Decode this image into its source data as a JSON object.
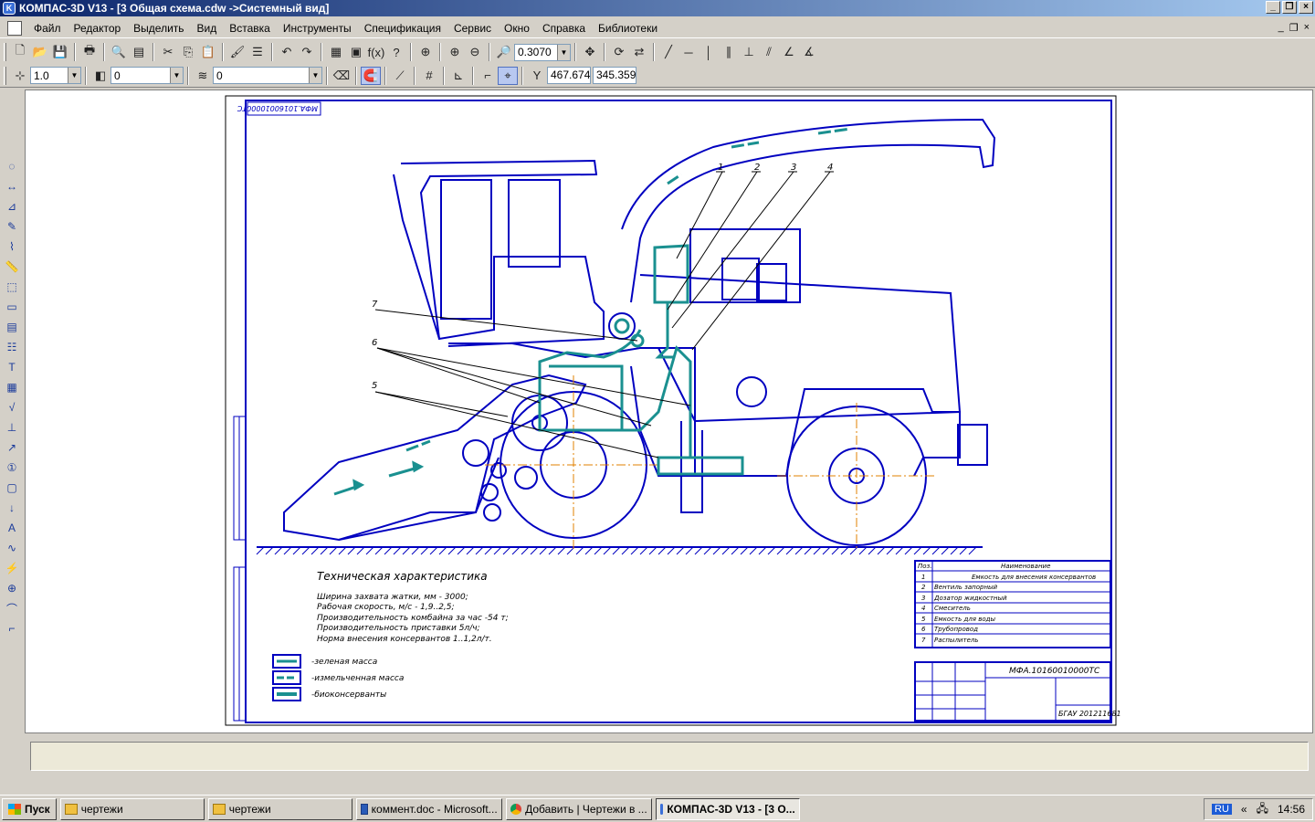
{
  "window": {
    "title": "КОМПАС-3D V13 - [3 Общая схема.cdw ->Системный вид]"
  },
  "menu": [
    "Файл",
    "Редактор",
    "Выделить",
    "Вид",
    "Вставка",
    "Инструменты",
    "Спецификация",
    "Сервис",
    "Окно",
    "Справка",
    "Библиотеки"
  ],
  "toolbar1": {
    "zoom_value": "0.3070"
  },
  "toolbar2": {
    "scale_value": "1.0",
    "layer_value": "0",
    "style_value": "0",
    "x_label": "Y",
    "coord_x": "467.674",
    "coord_y": "345.359"
  },
  "drawing": {
    "stamp_top": "МФА.10160010000ТС",
    "tech_title": "Техническая характеристика",
    "tech_lines": [
      "Ширина захвата жатки, мм - 3000;",
      "Рабочая скорость, м/с - 1,9..2,5;",
      "Производительность комбайна за час -54 т;",
      "Производительность приставки 5л/ч;",
      "Норма внесения консервантов 1..1,2л/т."
    ],
    "legend": [
      "-зеленая масса",
      "-измельченная масса",
      "-биоконсерванты"
    ],
    "callouts": [
      "1",
      "2",
      "3",
      "4",
      "5",
      "6",
      "7"
    ],
    "spec_header": [
      "Поз.",
      "Наименование"
    ],
    "spec_rows": [
      [
        "1",
        "Емкость для внесения консервантов"
      ],
      [
        "2",
        "Вентиль запорный"
      ],
      [
        "3",
        "Дозатор жидкостный"
      ],
      [
        "4",
        "Смеситель"
      ],
      [
        "5",
        "Емкость для воды"
      ],
      [
        "6",
        "Трубопровод"
      ],
      [
        "7",
        "Распылитель"
      ]
    ],
    "title_block_code": "МФА.10160010000ТС",
    "title_block_org": "БГАУ 201211681"
  },
  "taskbar": {
    "start": "Пуск",
    "tasks": [
      {
        "label": "чертежи",
        "icon": "folder-icon",
        "active": false
      },
      {
        "label": "чертежи",
        "icon": "folder-icon",
        "active": false
      },
      {
        "label": "коммент.doc - Microsoft...",
        "icon": "word-icon",
        "active": false
      },
      {
        "label": "Добавить | Чертежи в ...",
        "icon": "chrome-icon",
        "active": false
      },
      {
        "label": "КОМПАС-3D V13 - [3 О...",
        "icon": "kompas-icon",
        "active": true
      }
    ],
    "lang": "RU",
    "clock": "14:56"
  }
}
